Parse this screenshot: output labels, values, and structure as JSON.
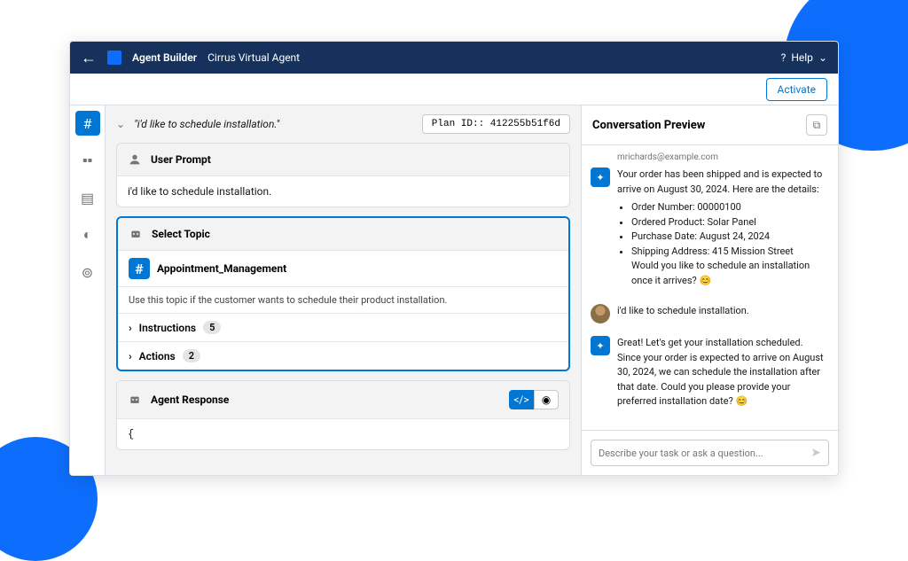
{
  "topbar": {
    "back": "←",
    "section": "Agent Builder",
    "title": "Cirrus Virtual Agent",
    "help": "Help"
  },
  "activate": "Activate",
  "prompt_quoted": "\"i'd like to schedule installation.\"",
  "plan_id": "Plan ID:: 412255b51f6d",
  "user_prompt": {
    "label": "User Prompt",
    "text": "i'd like to schedule installation."
  },
  "select_topic": {
    "label": "Select Topic",
    "topic_name": "Appointment_Management",
    "topic_desc": "Use this topic if the customer wants to schedule their product installation.",
    "instructions_label": "Instructions",
    "instructions_count": "5",
    "actions_label": "Actions",
    "actions_count": "2"
  },
  "agent_response": {
    "label": "Agent Response",
    "body": "{"
  },
  "preview": {
    "title": "Conversation Preview",
    "email": "mrichards@example.com",
    "msg1_intro": "Your order has been shipped and is expected to arrive on August 30, 2024. Here are the details:",
    "msg1_b1": "Order Number: 00000100",
    "msg1_b2": "Ordered Product: Solar Panel",
    "msg1_b3": "Purchase Date: August 24, 2024",
    "msg1_b4": "Shipping Address: 415 Mission Street",
    "msg1_out": "Would you like to schedule an installation once it arrives? 😊",
    "msg2": "i'd like to schedule installation.",
    "msg3": "Great! Let's get your installation scheduled. Since your order is expected to arrive on August 30, 2024, we can schedule the installation after that date. Could you please provide your preferred installation date? 😊",
    "placeholder": "Describe your task or ask a question..."
  }
}
